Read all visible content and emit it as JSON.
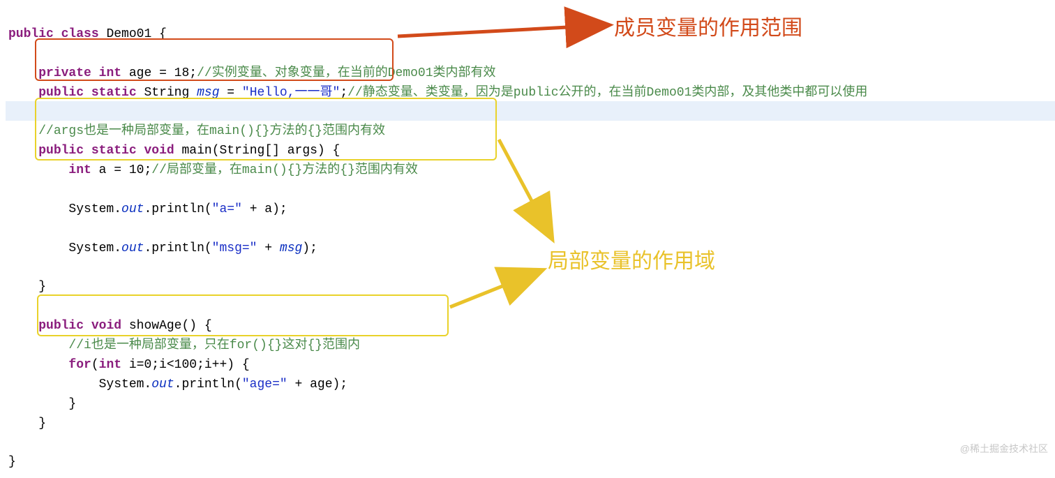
{
  "code": {
    "l1_public": "public",
    "l1_class": "class",
    "l1_name": "Demo01 {",
    "l2_private": "private",
    "l2_int": "int",
    "l2_age": "age = 18;",
    "l2_comment": "//实例变量、对象变量，",
    "l2_comment_tail": "在当前的Demo01类内部有效",
    "l3_public": "public",
    "l3_static": "static",
    "l3_string": "String",
    "l3_msg": "msg",
    "l3_eq": " = ",
    "l3_str": "\"Hello,一一哥\"",
    "l3_semi": ";",
    "l3_comment": "//静态变量、类变量，因为是public公开的，在当前Demo01类内部，及其他类中都可以使用",
    "l4_comment": "//args也是一种局部变量，在main(){}方法的{}范围内有效",
    "l5_public": "public",
    "l5_static": "static",
    "l5_void": "void",
    "l5_main": "main(String[] args) {",
    "l6_int": "int",
    "l6_a": "a = 10;",
    "l6_comment": "//局部变量，在main(){}方法的{}范围内有效",
    "l7_pre": "System.",
    "l7_out": "out",
    "l7_mid": ".println(",
    "l7_str": "\"a=\"",
    "l7_post": " + a);",
    "l8_pre": "System.",
    "l8_out": "out",
    "l8_mid": ".println(",
    "l8_str": "\"msg=\"",
    "l8_plus": " + ",
    "l8_msg": "msg",
    "l8_post": ");",
    "l9_brace": "}",
    "l10_public": "public",
    "l10_void": "void",
    "l10_show": "showAge() {",
    "l11_comment": "//i也是一种局部变量，只在for(){}这对{}范围内",
    "l12_for": "for",
    "l12_int": "int",
    "l12_body": " i=0;i<100;i++) {",
    "l12_open": "(",
    "l13_pre": "System.",
    "l13_out": "out",
    "l13_mid": ".println(",
    "l13_str": "\"age=\"",
    "l13_post": " + age);",
    "l14_brace": "}",
    "l15_brace": "}",
    "l16_brace": "}"
  },
  "annotations": {
    "member_scope": "成员变量的作用范围",
    "local_scope": "局部变量的作用域"
  },
  "watermark": "@稀土掘金技术社区"
}
